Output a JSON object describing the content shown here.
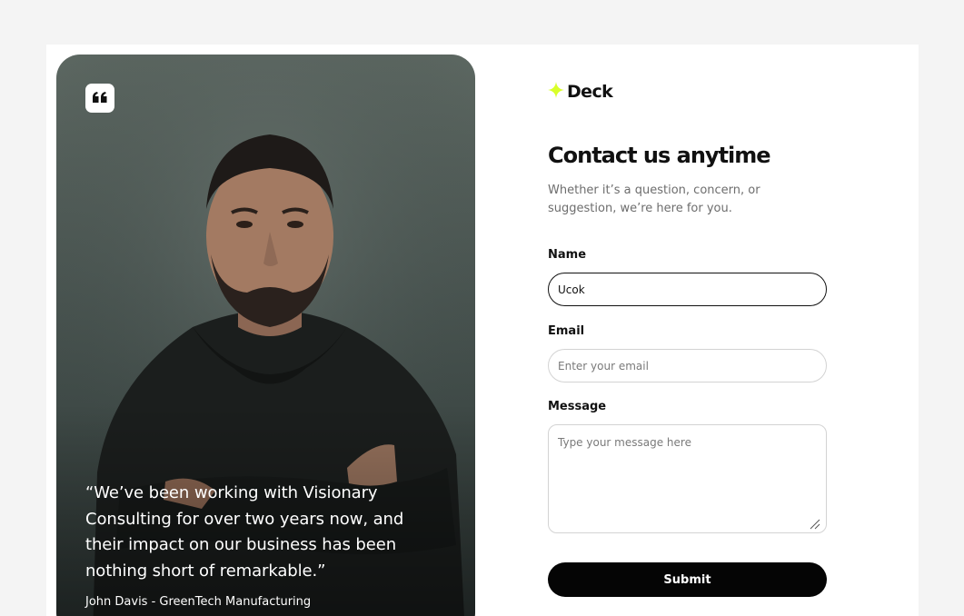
{
  "brand": {
    "name": "Deck",
    "accent_color": "#d9ff2a",
    "icon": "sparkle-star-icon"
  },
  "testimonial": {
    "icon": "quote-icon",
    "quote": "“We’ve been working with Visionary Consulting for over two years now, and their impact on our business has been nothing short of remarkable.”",
    "author": "John Davis - GreenTech Manufacturing"
  },
  "contact": {
    "title": "Contact us anytime",
    "subtitle": "Whether it’s a question, concern, or suggestion, we’re here for you.",
    "name_label": "Name",
    "name_value": "Ucok",
    "email_label": "Email",
    "email_placeholder": "Enter your email",
    "message_label": "Message",
    "message_placeholder": "Type your message here",
    "submit_label": "Submit"
  },
  "colors": {
    "page_background": "#f4f4f4",
    "button_background": "#050505",
    "text_primary": "#111111",
    "text_muted": "#6d6d6d"
  }
}
